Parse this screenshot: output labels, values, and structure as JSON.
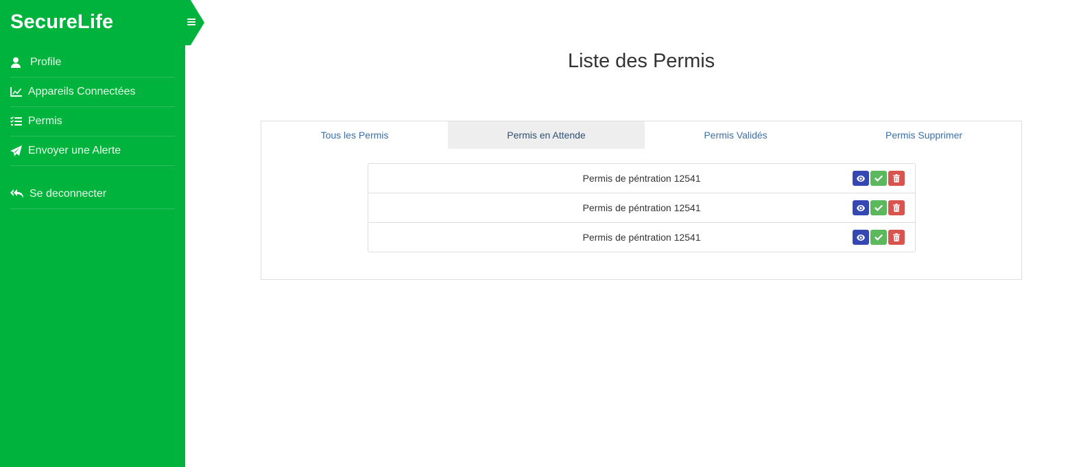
{
  "brand": "SecureLife",
  "sidebar": {
    "items": [
      {
        "label": "Profile",
        "icon": "user-icon"
      },
      {
        "label": "Appareils Connectées",
        "icon": "line-chart-icon"
      },
      {
        "label": "Permis",
        "icon": "tasks-icon"
      },
      {
        "label": "Envoyer une Alerte",
        "icon": "paper-plane-icon"
      }
    ],
    "logout": {
      "label": "Se deconnecter",
      "icon": "reply-all-icon"
    }
  },
  "toggle_icon": "hamburger-icon",
  "page": {
    "title": "Liste des Permis"
  },
  "tabs": [
    {
      "label": "Tous les Permis",
      "active": false
    },
    {
      "label": "Permis en Attende",
      "active": true
    },
    {
      "label": "Permis Validés",
      "active": false
    },
    {
      "label": "Permis Supprimer",
      "active": false
    }
  ],
  "permits": [
    {
      "name": "Permis de péntration 12541"
    },
    {
      "name": "Permis de péntration 12541"
    },
    {
      "name": "Permis de péntration 12541"
    }
  ],
  "colors": {
    "sidebar": "#00b33c",
    "view_button": "#3547b3",
    "validate_button": "#5cb85c",
    "delete_button": "#d9534f",
    "tab_link": "#3a6ea8"
  }
}
